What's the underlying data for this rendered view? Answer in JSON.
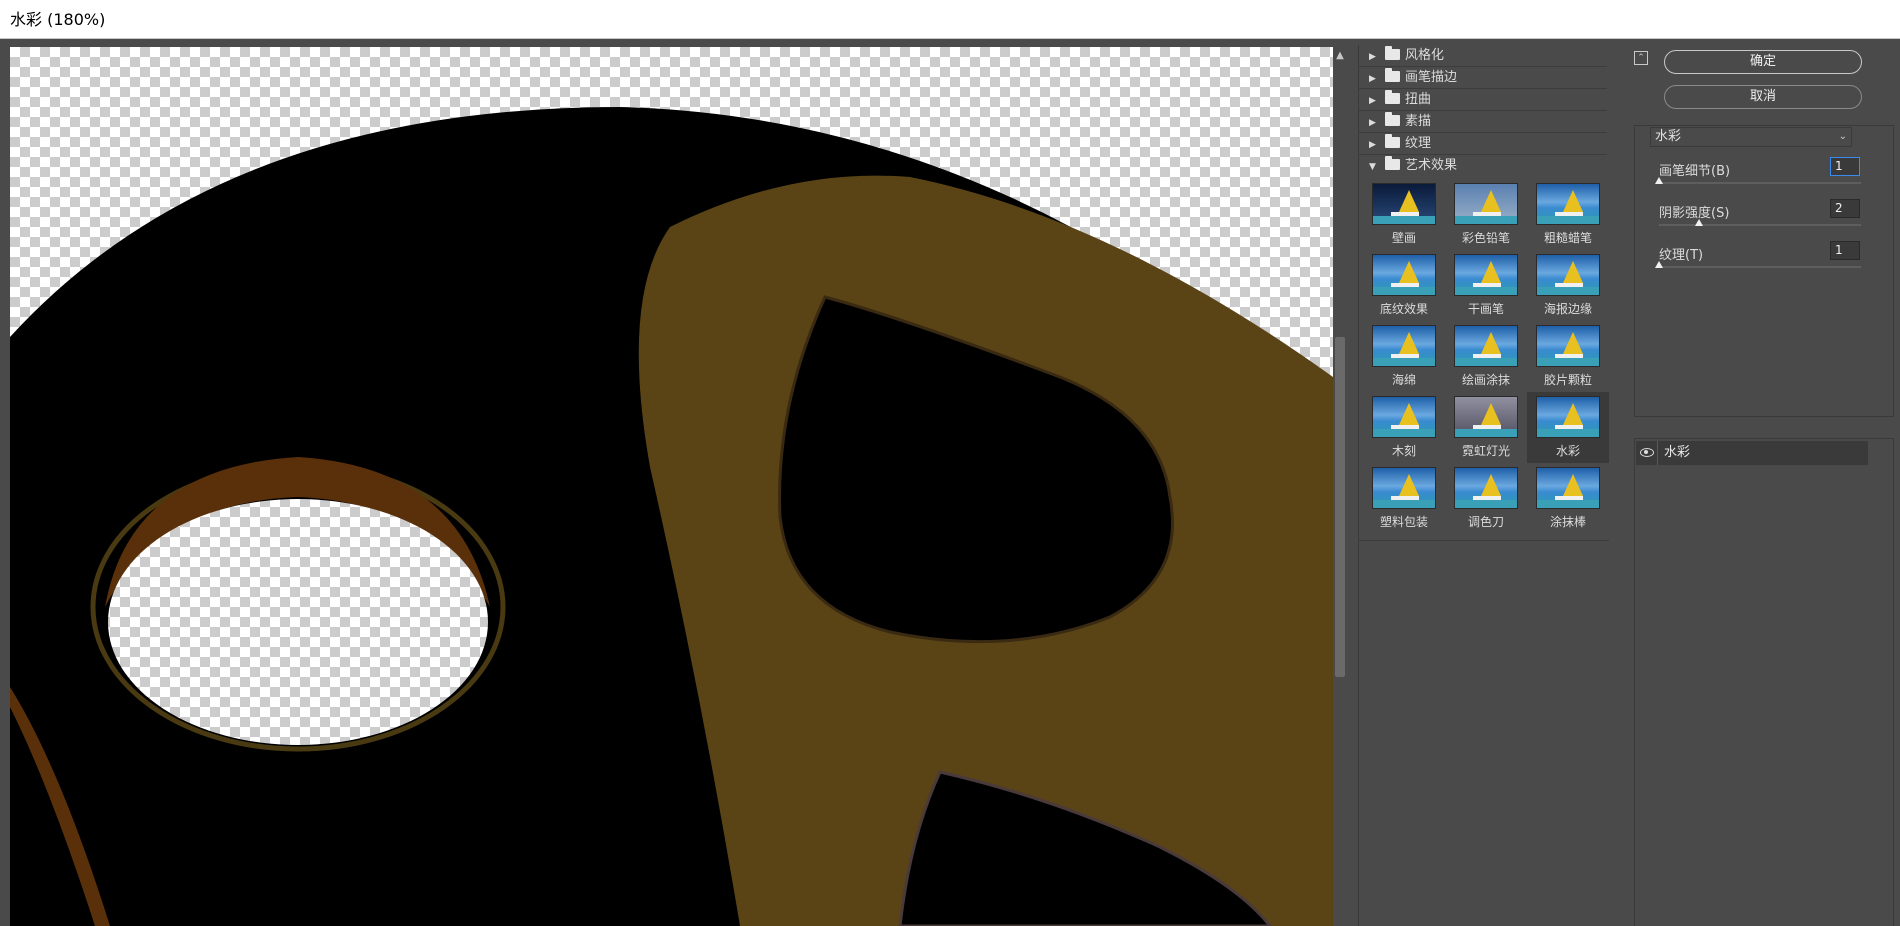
{
  "window": {
    "title": "水彩 (180%)"
  },
  "gallery": {
    "categories": [
      {
        "label": "风格化",
        "expanded": false
      },
      {
        "label": "画笔描边",
        "expanded": false
      },
      {
        "label": "扭曲",
        "expanded": false
      },
      {
        "label": "素描",
        "expanded": false
      },
      {
        "label": "纹理",
        "expanded": false
      },
      {
        "label": "艺术效果",
        "expanded": true
      }
    ],
    "filters": [
      {
        "label": "壁画"
      },
      {
        "label": "彩色铅笔"
      },
      {
        "label": "粗糙蜡笔"
      },
      {
        "label": "底纹效果"
      },
      {
        "label": "干画笔"
      },
      {
        "label": "海报边缘"
      },
      {
        "label": "海绵"
      },
      {
        "label": "绘画涂抹"
      },
      {
        "label": "胶片颗粒"
      },
      {
        "label": "木刻"
      },
      {
        "label": "霓虹灯光"
      },
      {
        "label": "水彩",
        "selected": true
      },
      {
        "label": "塑料包装"
      },
      {
        "label": "调色刀"
      },
      {
        "label": "涂抹棒"
      }
    ]
  },
  "buttons": {
    "ok": "确定",
    "cancel": "取消"
  },
  "settings": {
    "selected_filter": "水彩",
    "params": [
      {
        "label": "画笔细节(B)",
        "value": "1",
        "slider_fraction": 0.0
      },
      {
        "label": "阴影强度(S)",
        "value": "2",
        "slider_fraction": 0.2
      },
      {
        "label": "纹理(T)",
        "value": "1",
        "slider_fraction": 0.0
      }
    ]
  },
  "layers": [
    {
      "name": "水彩",
      "visible": true
    }
  ],
  "colors": {
    "panel_bg": "#4a4a4a",
    "artwork_black": "#000000",
    "artwork_brown": "#5a4416",
    "artwork_dark_brown": "#5a300a",
    "focus_blue": "#3a8bf0"
  }
}
